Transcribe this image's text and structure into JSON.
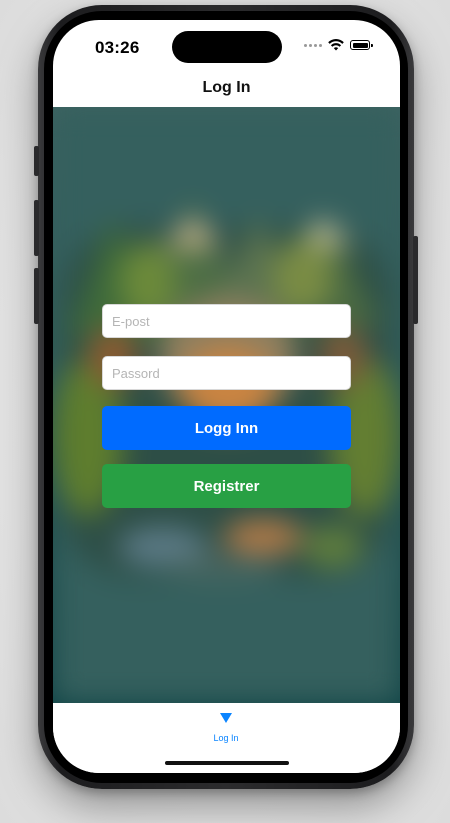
{
  "status_bar": {
    "time": "03:26"
  },
  "nav": {
    "title": "Log In"
  },
  "login_form": {
    "email_placeholder": "E-post",
    "email_value": "",
    "password_placeholder": "Passord",
    "password_value": "",
    "login_button_label": "Logg Inn",
    "register_button_label": "Registrer"
  },
  "tab_bar": {
    "items": [
      {
        "label": "Log In",
        "icon": "triangle-down-icon",
        "selected": true
      }
    ]
  },
  "colors": {
    "accent_blue": "#006bff",
    "register_green": "#28a044",
    "tab_active": "#0a84ff"
  }
}
